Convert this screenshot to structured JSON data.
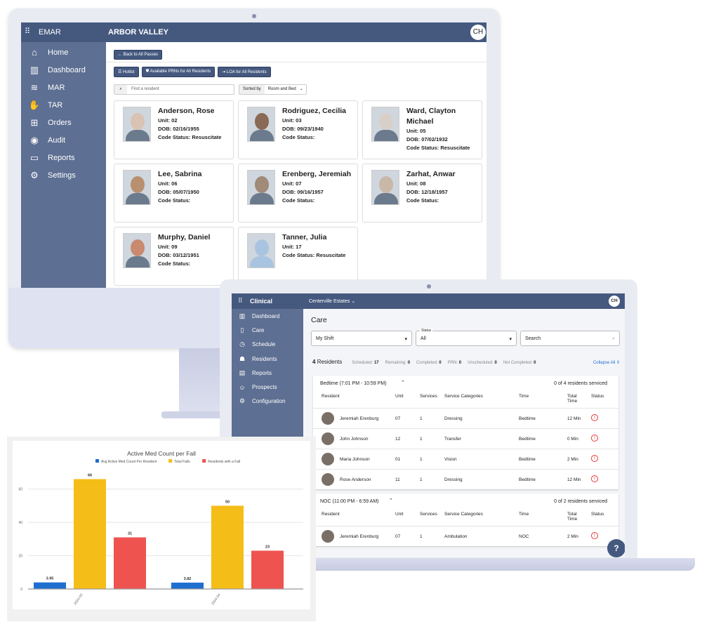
{
  "emar": {
    "app_title": "EMAR",
    "facility": "ARBOR VALLEY",
    "user_initials": "CH",
    "sidebar": [
      {
        "icon": "home-icon",
        "glyph": "⌂",
        "label": "Home"
      },
      {
        "icon": "bar-chart-icon",
        "glyph": "▥",
        "label": "Dashboard"
      },
      {
        "icon": "layers-icon",
        "glyph": "≋",
        "label": "MAR"
      },
      {
        "icon": "hand-icon",
        "glyph": "✋",
        "label": "TAR"
      },
      {
        "icon": "medical-bag-icon",
        "glyph": "⊞",
        "label": "Orders"
      },
      {
        "icon": "eye-icon",
        "glyph": "◉",
        "label": "Audit"
      },
      {
        "icon": "folder-icon",
        "glyph": "▭",
        "label": "Reports"
      },
      {
        "icon": "gear-icon",
        "glyph": "⚙",
        "label": "Settings"
      }
    ],
    "back_button": "Back to All Passes",
    "actions": [
      "Hotlist",
      "Available PRNs for All Residents",
      "LOA for All Residents"
    ],
    "search_placeholder": "Find a resident",
    "sort_label": "Sorted by",
    "sort_value": "Room and Bed",
    "residents": [
      {
        "name": "Anderson, Rose",
        "unit": "Unit: 02",
        "dob_label": "DOB: ",
        "dob": "02/16/1955",
        "code_label": "Code Status: ",
        "code": "Resuscitate"
      },
      {
        "name": "Rodriguez, Cecilia",
        "unit": "Unit: 03",
        "dob_label": "DOB: ",
        "dob": "09/23/1940",
        "code_label": "Code Status: ",
        "code": ""
      },
      {
        "name": "Ward, Clayton Michael",
        "unit": "Unit: 05",
        "dob_label": "DOB: ",
        "dob": "07/02/1932",
        "code_label": "Code Status: ",
        "code": "Resuscitate"
      },
      {
        "name": "Lee, Sabrina",
        "unit": "Unit: 06",
        "dob_label": "DOB: ",
        "dob": "05/07/1950",
        "code_label": "Code Status: ",
        "code": ""
      },
      {
        "name": "Erenberg, Jeremiah",
        "unit": "Unit: 07",
        "dob_label": "DOB: ",
        "dob": "09/16/1957",
        "code_label": "Code Status: ",
        "code": ""
      },
      {
        "name": "Zarhat, Anwar",
        "unit": "Unit: 08",
        "dob_label": "DOB: ",
        "dob": "12/18/1957",
        "code_label": "Code Status: ",
        "code": ""
      },
      {
        "name": "Murphy, Daniel",
        "unit": "Unit: 09",
        "dob_label": "DOB: ",
        "dob": "03/12/1951",
        "code_label": "Code Status: ",
        "code": ""
      },
      {
        "name": "Tanner, Julia",
        "unit": "Unit: 17",
        "dob_label": "",
        "dob": "",
        "code_label": "Code Status: ",
        "code": "Resuscitate"
      }
    ]
  },
  "clinical": {
    "app_title": "Clinical",
    "facility": "Centerville Estates",
    "user_initials": "CH",
    "sidebar": [
      {
        "icon": "bar-chart-icon",
        "glyph": "▥",
        "label": "Dashboard"
      },
      {
        "icon": "clipboard-icon",
        "glyph": "▯",
        "label": "Care"
      },
      {
        "icon": "clock-icon",
        "glyph": "◷",
        "label": "Schedule"
      },
      {
        "icon": "residents-icon",
        "glyph": "☗",
        "label": "Residents"
      },
      {
        "icon": "document-icon",
        "glyph": "▤",
        "label": "Reports"
      },
      {
        "icon": "person-circle-icon",
        "glyph": "☺",
        "label": "Prospects"
      },
      {
        "icon": "gear-icon",
        "glyph": "⚙",
        "label": "Configuration"
      }
    ],
    "page_title": "Care",
    "shift_select": "My Shift",
    "status_label": "Status",
    "status_value": "All",
    "search_placeholder": "Search",
    "residents_count": "4",
    "residents_label": "Residents",
    "stats": [
      {
        "label": "Scheduled:",
        "value": "17"
      },
      {
        "label": "Remaining:",
        "value": "0"
      },
      {
        "label": "Completed:",
        "value": "0"
      },
      {
        "label": "PRN:",
        "value": "0"
      },
      {
        "label": "Unscheduled:",
        "value": "0"
      },
      {
        "label": "Not Completed:",
        "value": "0"
      }
    ],
    "collapse_all": "Collapse All",
    "columns": [
      "Resident",
      "Unit",
      "Services",
      "Service Categories",
      "Time",
      "Total Time",
      "Status"
    ],
    "groups": [
      {
        "title": "Bedtime (7:01 PM - 10:59 PM)",
        "serviced": "0 of 4 residents serviced",
        "rows": [
          {
            "resident": "Jeremiah Erenburg",
            "unit": "07",
            "services": "1",
            "category": "Dressing",
            "time": "Bedtime",
            "total": "12 Min"
          },
          {
            "resident": "John Johnson",
            "unit": "12",
            "services": "1",
            "category": "Transfer",
            "time": "Bedtime",
            "total": "0 Min"
          },
          {
            "resident": "Maria Johnson",
            "unit": "01",
            "services": "1",
            "category": "Vision",
            "time": "Bedtime",
            "total": "2 Min"
          },
          {
            "resident": "Rose Anderson",
            "unit": "11",
            "services": "1",
            "category": "Dressing",
            "time": "Bedtime",
            "total": "12 Min"
          }
        ]
      },
      {
        "title": "NOC (11:00 PM - 6:59 AM)",
        "serviced": "0 of 2 residents serviced",
        "rows": [
          {
            "resident": "Jeremiah Erenburg",
            "unit": "07",
            "services": "1",
            "category": "Ambulation",
            "time": "NOC",
            "total": "2 Min"
          }
        ]
      }
    ],
    "status_icon": "alert-circle-icon",
    "status_color": "#e53935"
  },
  "chart_data": {
    "type": "bar",
    "title": "Active Med Count per Fall",
    "categories": [
      "2024-03",
      "2024-04"
    ],
    "series": [
      {
        "name": "Avg Active Med Count Per Resident",
        "values": [
          3.95,
          3.82
        ],
        "color": "#1e6fd0"
      },
      {
        "name": "Total Falls",
        "values": [
          66,
          50
        ],
        "color": "#f5bd17"
      },
      {
        "name": "Residents with a Fall",
        "values": [
          31,
          23
        ],
        "color": "#ef5350"
      }
    ],
    "yticks": [
      0,
      20,
      40,
      60
    ],
    "ylim": [
      0,
      70
    ],
    "grid": true,
    "legend": "top"
  },
  "colors": {
    "header": "#45597f",
    "sidebar": "#5d6f92",
    "link": "#1e6fd0"
  }
}
